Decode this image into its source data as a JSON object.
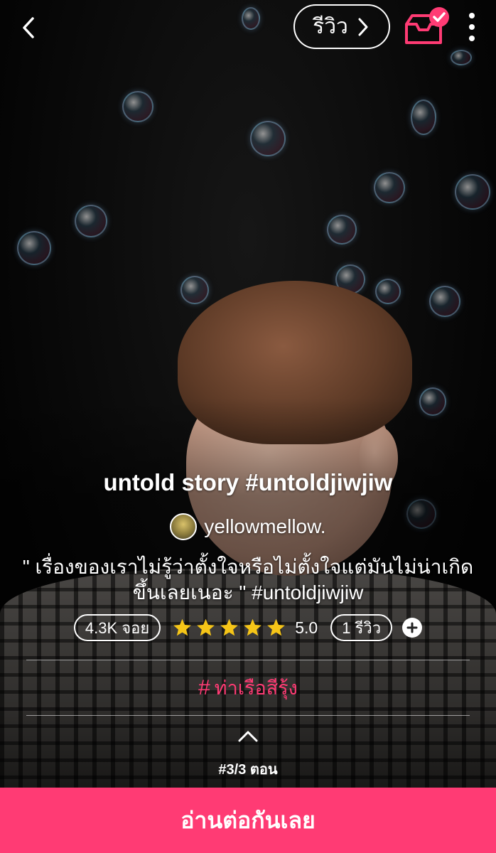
{
  "header": {
    "review_label": "รีวิว",
    "back_icon": "chevron-left-icon",
    "shelf_icon": "bookshelf-check-icon",
    "menu_icon": "vertical-dots-icon",
    "accent": "#ff3b74"
  },
  "story": {
    "title": "untold story #untoldjiwjiw",
    "author": "yellowmellow.",
    "description": "\" เรื่องของเราไม่รู้ว่าตั้งใจหรือไม่ตั้งใจแต่มันไม่น่าเกิดขึ้นเลยเนอะ \" #untoldjiwjiw",
    "views": "4.3K จอย",
    "rating": "5.0",
    "rating_fraction": 1.0,
    "reviews": "1 รีวิว",
    "tag_symbol": "#",
    "tag": "ท่าเรือสีรุ้ง",
    "episode": "#3/3 ตอน"
  },
  "cta": {
    "read_label": "อ่านต่อกันเลย",
    "color": "#ff3b74"
  },
  "colors": {
    "star": "#f5c518",
    "accent": "#ff3b74"
  }
}
